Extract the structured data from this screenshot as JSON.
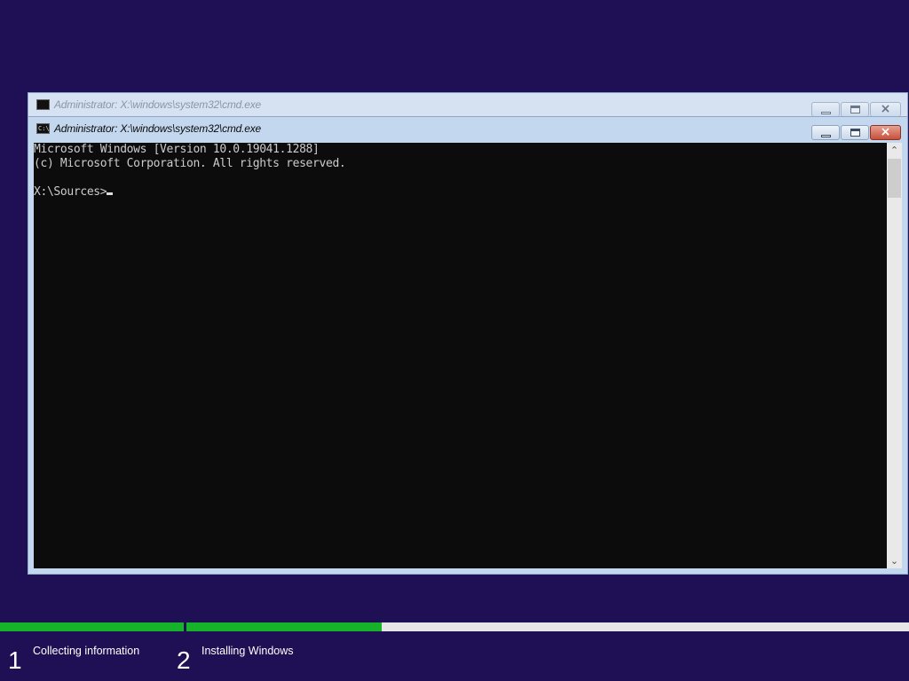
{
  "background_window": {
    "title": "Administrator: X:\\windows\\system32\\cmd.exe",
    "icon": "console-app-icon",
    "buttons": {
      "minimize": "minimize-icon",
      "maximize": "maximize-icon",
      "close_glyph": "×"
    }
  },
  "foreground_window": {
    "title": "Administrator: X:\\windows\\system32\\cmd.exe",
    "icon": "console-app-icon",
    "icon_text": "C:\\",
    "buttons": {
      "minimize": "minimize-icon",
      "maximize": "maximize-icon",
      "close_glyph": "×"
    },
    "console": {
      "lines": [
        "Microsoft Windows [Version 10.0.19041.1288]",
        "(c) Microsoft Corporation. All rights reserved.",
        "",
        "X:\\Sources>"
      ],
      "background": "#0c0c0c",
      "foreground": "#cccccc"
    },
    "scrollbar": {
      "up_glyph": "⌃",
      "down_glyph": "⌄"
    }
  },
  "setup_progress": {
    "steps": [
      {
        "number": "1",
        "label": "Collecting information",
        "completed_fraction": 1.0
      },
      {
        "number": "2",
        "label": "Installing Windows",
        "completed_fraction": 0.27
      }
    ],
    "fill_color": "#16b22a",
    "track_color": "#e6e6e6"
  },
  "colors": {
    "desktop_background": "#1f0f54",
    "close_button": "#c7503b"
  }
}
